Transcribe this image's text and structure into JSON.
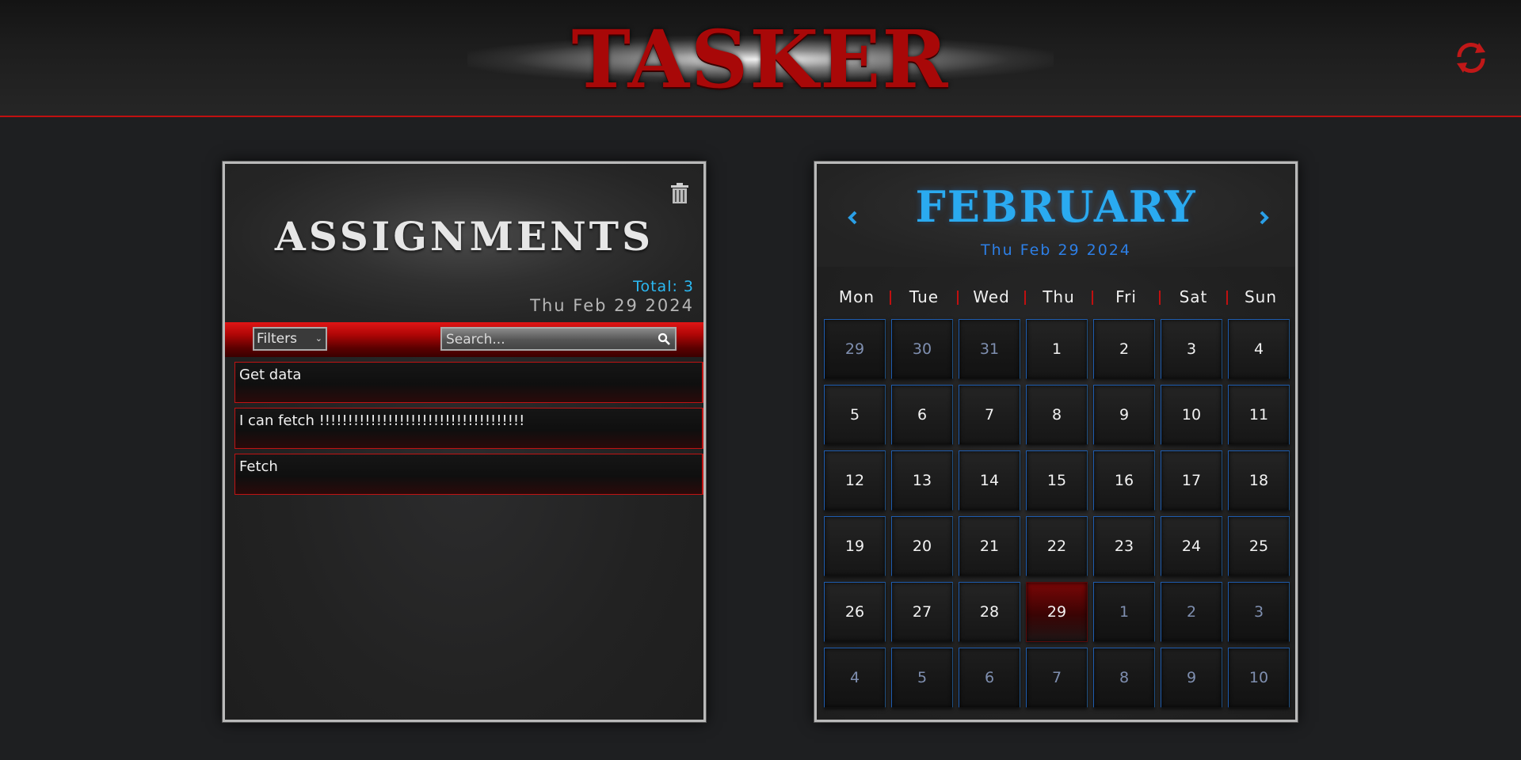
{
  "app": {
    "title": "TASKER"
  },
  "assignments": {
    "title": "ASSIGNMENTS",
    "total_label": "Total: 3",
    "date": "Thu Feb 29 2024",
    "filter_label": "Filters",
    "search_placeholder": "Search...",
    "tasks": [
      {
        "title": "Get data"
      },
      {
        "title": "I can fetch !!!!!!!!!!!!!!!!!!!!!!!!!!!!!!!!!!!!"
      },
      {
        "title": "Fetch"
      }
    ]
  },
  "calendar": {
    "month": "FEBRUARY",
    "date": "Thu Feb 29 2024",
    "weekdays": [
      "Mon",
      "Tue",
      "Wed",
      "Thu",
      "Fri",
      "Sat",
      "Sun"
    ],
    "days": [
      {
        "n": "29",
        "o": true
      },
      {
        "n": "30",
        "o": true
      },
      {
        "n": "31",
        "o": true
      },
      {
        "n": "1"
      },
      {
        "n": "2"
      },
      {
        "n": "3"
      },
      {
        "n": "4"
      },
      {
        "n": "5"
      },
      {
        "n": "6"
      },
      {
        "n": "7"
      },
      {
        "n": "8"
      },
      {
        "n": "9"
      },
      {
        "n": "10"
      },
      {
        "n": "11"
      },
      {
        "n": "12"
      },
      {
        "n": "13"
      },
      {
        "n": "14"
      },
      {
        "n": "15"
      },
      {
        "n": "16"
      },
      {
        "n": "17"
      },
      {
        "n": "18"
      },
      {
        "n": "19"
      },
      {
        "n": "20"
      },
      {
        "n": "21"
      },
      {
        "n": "22"
      },
      {
        "n": "23"
      },
      {
        "n": "24"
      },
      {
        "n": "25"
      },
      {
        "n": "26"
      },
      {
        "n": "27"
      },
      {
        "n": "28"
      },
      {
        "n": "29",
        "today": true
      },
      {
        "n": "1",
        "o": true
      },
      {
        "n": "2",
        "o": true
      },
      {
        "n": "3",
        "o": true
      },
      {
        "n": "4",
        "o": true
      },
      {
        "n": "5",
        "o": true
      },
      {
        "n": "6",
        "o": true
      },
      {
        "n": "7",
        "o": true
      },
      {
        "n": "8",
        "o": true
      },
      {
        "n": "9",
        "o": true
      },
      {
        "n": "10",
        "o": true
      }
    ]
  },
  "colors": {
    "accent_red": "#c01010",
    "accent_blue": "#2aaaf0",
    "today_red": "#7a0606"
  },
  "icons": {
    "refresh": "refresh-icon",
    "trash": "trash-icon",
    "search": "search-icon",
    "prev": "chevron-left-icon",
    "next": "chevron-right-icon"
  }
}
